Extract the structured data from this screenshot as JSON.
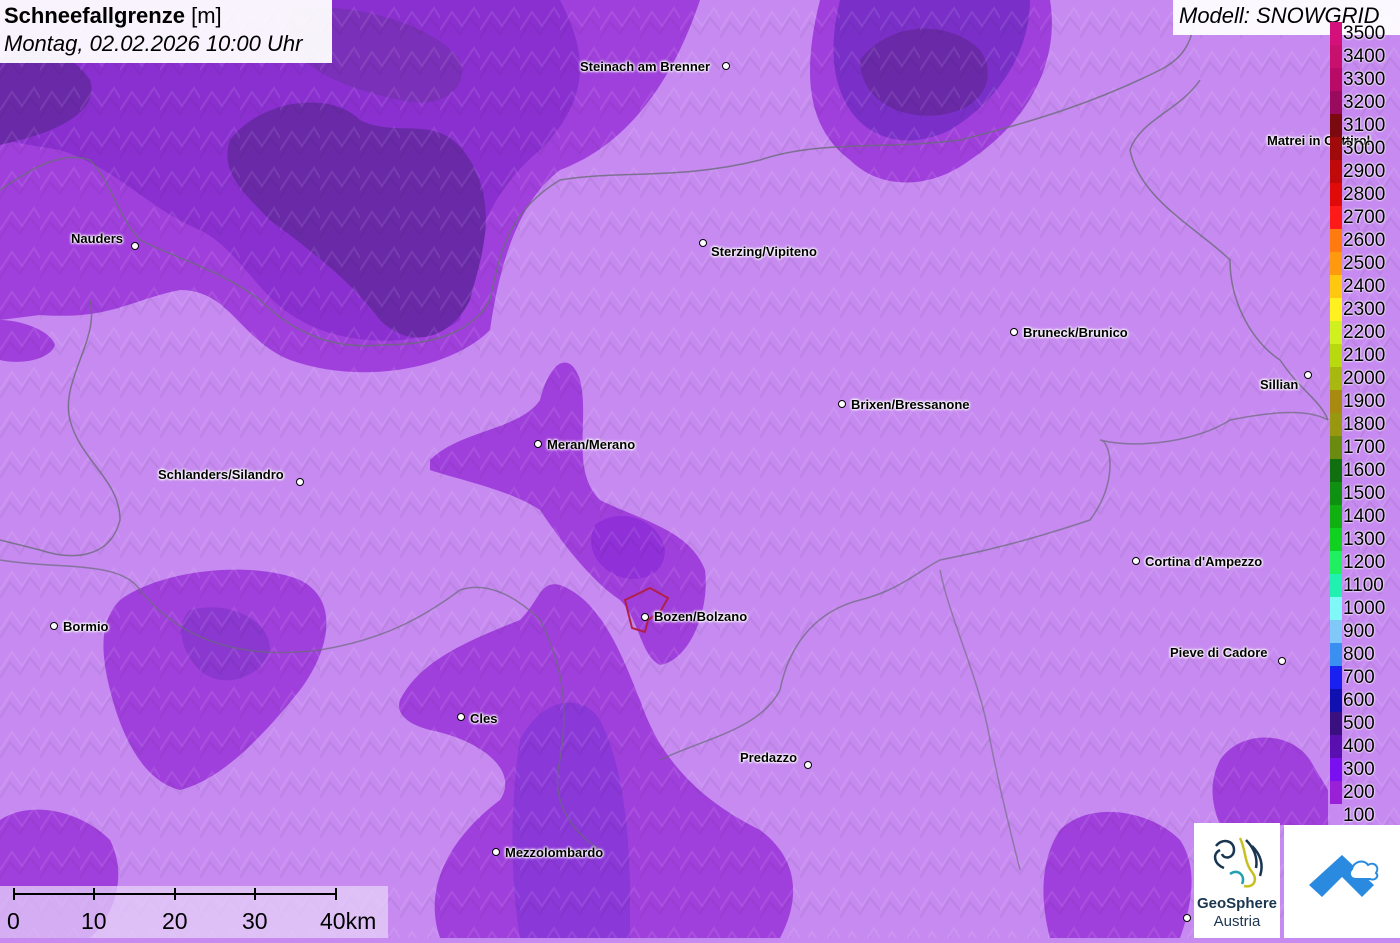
{
  "header": {
    "title": "Schneefallgrenze",
    "unit": "[m]",
    "datetime": "Montag, 02.02.2026 10:00 Uhr"
  },
  "model": {
    "label": "Modell: SNOWGRID"
  },
  "cities": [
    {
      "name": "Steinach am Brenner"
    },
    {
      "name": "Nauders"
    },
    {
      "name": "Sterzing/Vipiteno"
    },
    {
      "name": "Bruneck/Brunico"
    },
    {
      "name": "Sillian"
    },
    {
      "name": "Brixen/Bressanone"
    },
    {
      "name": "Meran/Merano"
    },
    {
      "name": "Schlanders/Silandro"
    },
    {
      "name": "Cortina d'Ampezzo"
    },
    {
      "name": "Bormio"
    },
    {
      "name": "Bozen/Bolzano"
    },
    {
      "name": "Pieve di Cadore"
    },
    {
      "name": "Cles"
    },
    {
      "name": "Predazzo"
    },
    {
      "name": "Mezzolombardo"
    },
    {
      "name": "Matrei in Osttirol"
    }
  ],
  "legend": [
    {
      "value": "3500",
      "color": "#d4107a"
    },
    {
      "value": "3400",
      "color": "#c8106e"
    },
    {
      "value": "3300",
      "color": "#b80a66"
    },
    {
      "value": "3200",
      "color": "#9a0a5e"
    },
    {
      "value": "3100",
      "color": "#7a0a10"
    },
    {
      "value": "3000",
      "color": "#a00a0a"
    },
    {
      "value": "2900",
      "color": "#c00a0a"
    },
    {
      "value": "2800",
      "color": "#e00a0a"
    },
    {
      "value": "2700",
      "color": "#ff1a1a"
    },
    {
      "value": "2600",
      "color": "#ff7a10"
    },
    {
      "value": "2500",
      "color": "#ff9a10"
    },
    {
      "value": "2400",
      "color": "#ffc810"
    },
    {
      "value": "2300",
      "color": "#fff020"
    },
    {
      "value": "2200",
      "color": "#d0f020"
    },
    {
      "value": "2100",
      "color": "#b8d810"
    },
    {
      "value": "2000",
      "color": "#a8b810"
    },
    {
      "value": "1900",
      "color": "#a88a10"
    },
    {
      "value": "1800",
      "color": "#989810"
    },
    {
      "value": "1700",
      "color": "#6a8a10"
    },
    {
      "value": "1600",
      "color": "#107010"
    },
    {
      "value": "1500",
      "color": "#109010"
    },
    {
      "value": "1400",
      "color": "#10b010"
    },
    {
      "value": "1300",
      "color": "#10d020"
    },
    {
      "value": "1200",
      "color": "#20f060"
    },
    {
      "value": "1100",
      "color": "#20f0b0"
    },
    {
      "value": "1000",
      "color": "#80f8f8"
    },
    {
      "value": "900",
      "color": "#80c8f8"
    },
    {
      "value": "800",
      "color": "#3a90f0"
    },
    {
      "value": "700",
      "color": "#1a20f0"
    },
    {
      "value": "600",
      "color": "#1010b0"
    },
    {
      "value": "500",
      "color": "#3a1080"
    },
    {
      "value": "400",
      "color": "#5a10b0"
    },
    {
      "value": "300",
      "color": "#7a10f0"
    },
    {
      "value": "200",
      "color": "#9a20d8"
    },
    {
      "value": "100",
      "color": "#c68af0"
    }
  ],
  "scale": {
    "labels": [
      "0",
      "10",
      "20",
      "30",
      "40km"
    ]
  },
  "logos": {
    "geosphere_line1": "GeoSphere",
    "geosphere_line2": "Austria"
  },
  "colors": {
    "base": "#c68af0",
    "mid": "#a040dc",
    "deep": "#7a28c8",
    "darkest": "#5a2090",
    "border": "#6a6a7a"
  }
}
